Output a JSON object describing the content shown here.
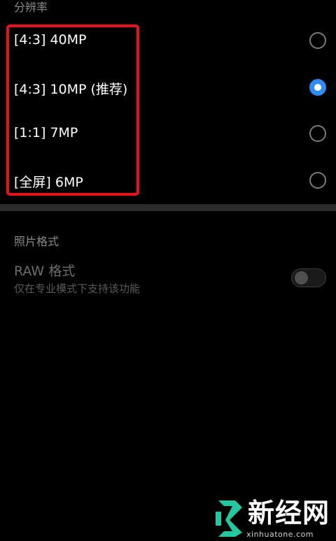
{
  "resolution_section": {
    "header": "分辨率",
    "options": [
      {
        "label": "[4:3] 40MP",
        "selected": false
      },
      {
        "label": "[4:3] 10MP (推荐)",
        "selected": true
      },
      {
        "label": "[1:1] 7MP",
        "selected": false
      },
      {
        "label": "[全屏] 6MP",
        "selected": false
      }
    ]
  },
  "photo_format_section": {
    "header": "照片格式",
    "raw_title": "RAW 格式",
    "raw_subtitle": "仅在专业模式下支持该功能",
    "raw_enabled": false
  },
  "watermark": {
    "text": "新经网",
    "url": "xinhuatone.com"
  },
  "colors": {
    "background": "#000000",
    "accent": "#2f8cf5",
    "highlight": "#e8121c",
    "watermark_icon": "#24c7a0"
  }
}
